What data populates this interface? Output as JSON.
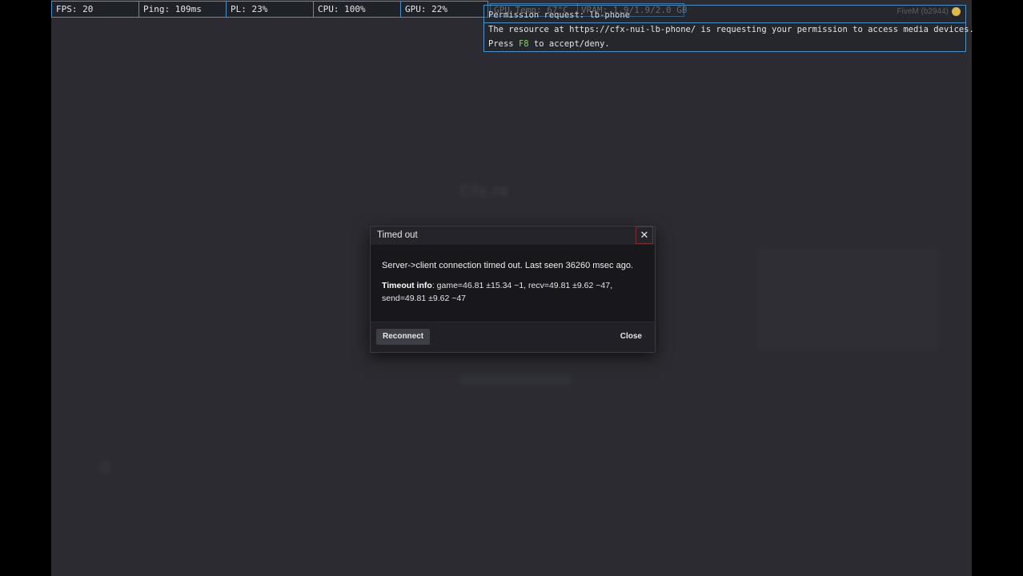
{
  "perf": {
    "fps": "FPS: 20",
    "ping": "Ping: 109ms",
    "pl": "PL: 23%",
    "cpu": "CPU: 100%",
    "gpu": "GPU: 22%",
    "gpu_temp": "GPU Temp: 67°C",
    "vram": "VRAM: 1.9/1.9/2.0 GB"
  },
  "permission": {
    "title": "Permission request: lb-phone",
    "line1": "The resource at https://cfx-nui-lb-phone/ is requesting your permission to access media devices.",
    "line2_prefix": "Press ",
    "line2_key": "F8",
    "line2_suffix": " to accept/deny."
  },
  "build_tag": "FiveM (b2944)",
  "background": {
    "logo_text": "Cfx.re"
  },
  "modal": {
    "title": "Timed out",
    "close_glyph": "✕",
    "message": "Server->client connection timed out. Last seen 36260 msec ago.",
    "info_label": "Timeout info",
    "info_text": ": game=46.81 ±15.34 ~1, recv=49.81 ±9.62 ~47, send=49.81 ±9.62 ~47",
    "reconnect_label": "Reconnect",
    "close_label": "Close"
  },
  "colors": {
    "overlay_border": "#4a90c8",
    "game_background": "#2b2b31",
    "modal_background": "#18181c",
    "key_highlight": "#7ed957"
  }
}
